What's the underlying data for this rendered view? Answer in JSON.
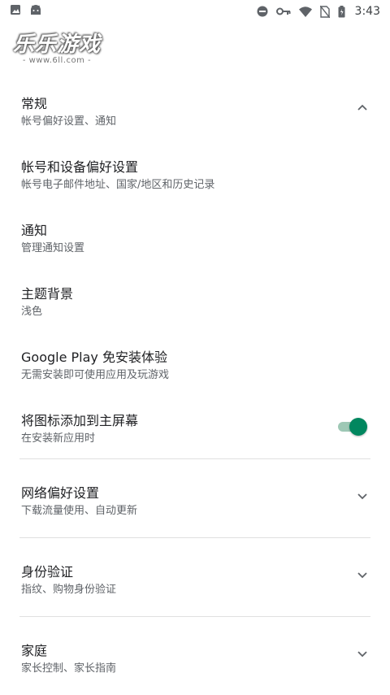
{
  "status_bar": {
    "time": "3:43",
    "left_icons": [
      "image-icon",
      "android-icon"
    ],
    "right_icons": [
      "do-not-disturb-icon",
      "vpn-key-icon",
      "wifi-icon",
      "no-sim-icon",
      "battery-icon"
    ]
  },
  "watermark": {
    "logo": "乐乐游戏",
    "url": "- www.6ll.com -"
  },
  "sections": {
    "general": {
      "title": "常规",
      "subtitle": "帐号偏好设置、通知",
      "expanded": true
    },
    "items": [
      {
        "title": "帐号和设备偏好设置",
        "subtitle": "帐号电子邮件地址、国家/地区和历史记录"
      },
      {
        "title": "通知",
        "subtitle": "管理通知设置"
      },
      {
        "title": "主题背景",
        "subtitle": "浅色"
      },
      {
        "title": "Google Play 免安装体验",
        "subtitle": "无需安装即可使用应用及玩游戏"
      },
      {
        "title": "将图标添加到主屏幕",
        "subtitle": "在安装新应用时",
        "toggle_on": true
      }
    ],
    "network": {
      "title": "网络偏好设置",
      "subtitle": "下载流量使用、自动更新"
    },
    "auth": {
      "title": "身份验证",
      "subtitle": "指纹、购物身份验证"
    },
    "family": {
      "title": "家庭",
      "subtitle": "家长控制、家长指南"
    }
  },
  "colors": {
    "accent": "#01875f",
    "toggle_track": "#9ec8b5",
    "text_primary": "#202124",
    "text_secondary": "#5f6368",
    "divider": "#e0e0e0"
  }
}
